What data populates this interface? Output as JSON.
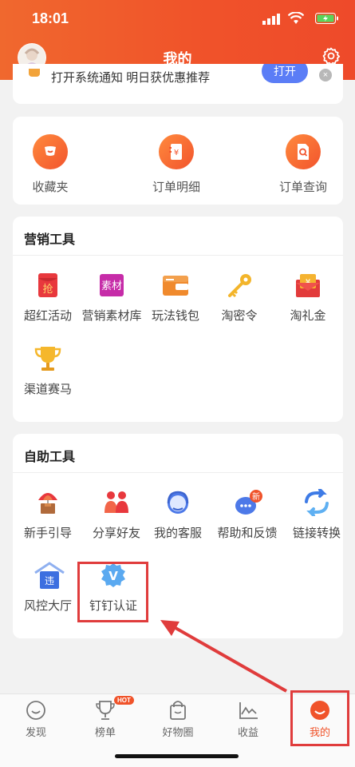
{
  "status": {
    "time": "18:01"
  },
  "header": {
    "title": "我的"
  },
  "notice": {
    "text": "打开系统通知 明日获优惠推荐",
    "button": "打开",
    "close": "×"
  },
  "top_items": [
    {
      "label": "收藏夹",
      "icon": "star-icon"
    },
    {
      "label": "订单明细",
      "icon": "receipt-icon"
    },
    {
      "label": "订单查询",
      "icon": "search-doc-icon"
    }
  ],
  "marketing": {
    "title": "营销工具",
    "items": [
      {
        "label": "超红活动",
        "icon": "red-envelope-icon"
      },
      {
        "label": "营销素材库",
        "icon": "material-icon",
        "badge": "素材"
      },
      {
        "label": "玩法钱包",
        "icon": "wallet-icon"
      },
      {
        "label": "淘密令",
        "icon": "key-icon"
      },
      {
        "label": "淘礼金",
        "icon": "gift-money-icon"
      },
      {
        "label": "渠道赛马",
        "icon": "trophy-icon"
      }
    ],
    "envelope_char": "抢",
    "gift_char": "¥"
  },
  "selftools": {
    "title": "自助工具",
    "items": [
      {
        "label": "新手引导",
        "icon": "guide-icon"
      },
      {
        "label": "分享好友",
        "icon": "share-friends-icon"
      },
      {
        "label": "我的客服",
        "icon": "customer-service-icon"
      },
      {
        "label": "帮助和反馈",
        "icon": "help-feedback-icon",
        "badge": "新"
      },
      {
        "label": "链接转换",
        "icon": "link-convert-icon"
      },
      {
        "label": "风控大厅",
        "icon": "risk-control-icon",
        "badge": "违"
      },
      {
        "label": "钉钉认证",
        "icon": "dingtalk-verify-icon",
        "badge": "V"
      }
    ]
  },
  "tabs": [
    {
      "label": "发现",
      "icon": "discover-icon",
      "active": false
    },
    {
      "label": "榜单",
      "icon": "trophy-tab-icon",
      "active": false,
      "badge": "HOT"
    },
    {
      "label": "好物圈",
      "icon": "bag-icon",
      "active": false
    },
    {
      "label": "收益",
      "icon": "chart-icon",
      "active": false
    },
    {
      "label": "我的",
      "icon": "profile-icon",
      "active": true
    }
  ],
  "colors": {
    "accent": "#f0532a",
    "highlight": "#e03c3c"
  }
}
